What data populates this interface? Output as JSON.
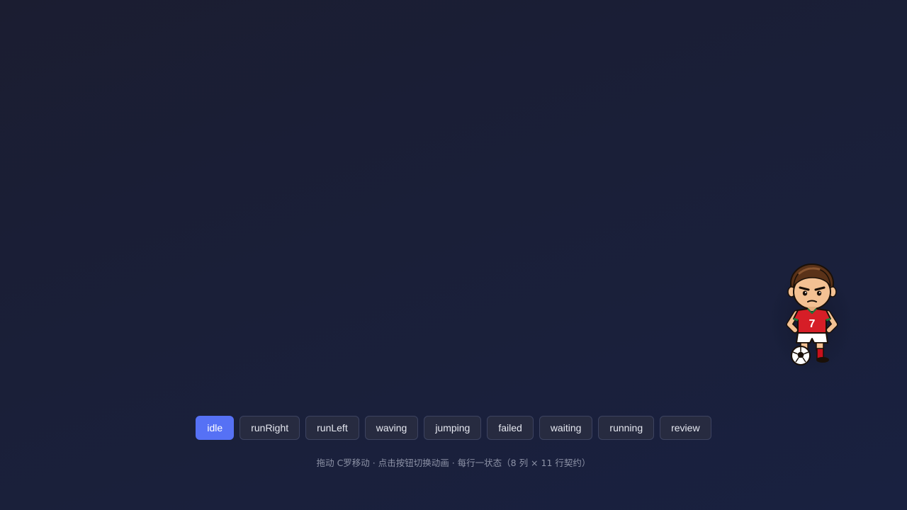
{
  "sprite": {
    "jersey_number": "7",
    "colors": {
      "jersey": "#d61e27",
      "shorts": "#ffffff",
      "socks": "#c8101c",
      "hair": "#5a3218",
      "skin": "#f3c193",
      "trim": "#1f7a3a"
    }
  },
  "controls": {
    "buttons": [
      {
        "label": "idle",
        "active": true
      },
      {
        "label": "runRight",
        "active": false
      },
      {
        "label": "runLeft",
        "active": false
      },
      {
        "label": "waving",
        "active": false
      },
      {
        "label": "jumping",
        "active": false
      },
      {
        "label": "failed",
        "active": false
      },
      {
        "label": "waiting",
        "active": false
      },
      {
        "label": "running",
        "active": false
      },
      {
        "label": "review",
        "active": false
      }
    ],
    "accent_color": "#5671f5"
  },
  "hint": {
    "text": "拖动 C罗移动 · 点击按钮切换动画 · 每行一状态（8 列 × 11 行契约）"
  }
}
